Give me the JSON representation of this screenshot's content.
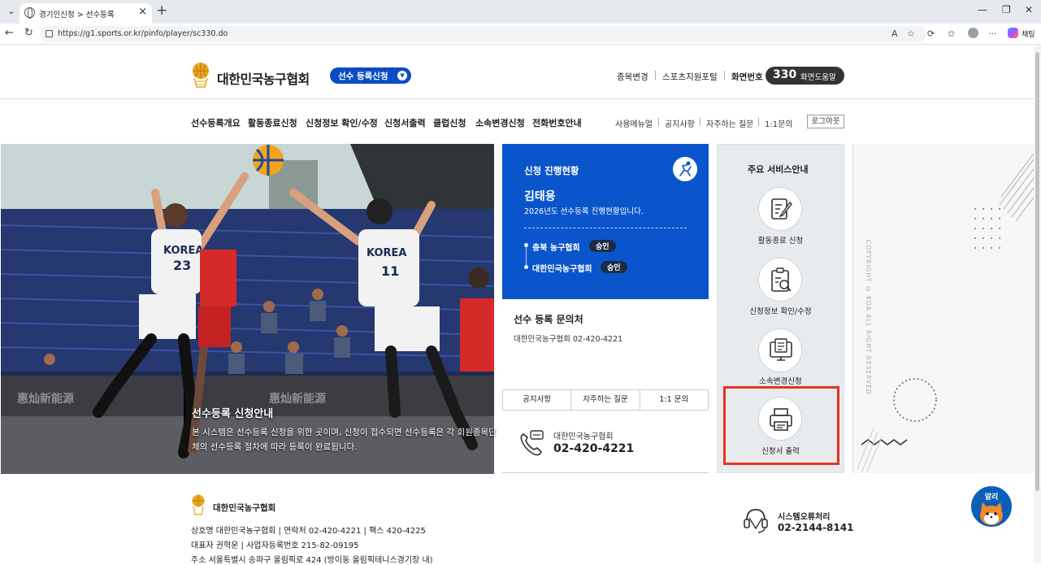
{
  "browser": {
    "tab_title": "경기인신청 > 선수등록",
    "url": "https://g1.sports.or.kr/pinfo/player/sc330.do",
    "chat_label": "채팅"
  },
  "header": {
    "org_name": "대한민국농구협회",
    "service_select": "선수 등록신청",
    "top_links": [
      "종목변경",
      "스포츠지원포털"
    ],
    "phone_label": "화면번호",
    "screen_number": "330",
    "help_label": "화면도움말"
  },
  "gnb": {
    "items": [
      "선수등록개요",
      "활동종료신청",
      "신청정보 확인/수정",
      "신청서출력",
      "클럽신청",
      "소속변경신청",
      "전화번호안내"
    ],
    "sub_links": [
      "사용메뉴얼",
      "공지사항",
      "자주하는 질문",
      "1:1문의"
    ],
    "logout": "로그아웃"
  },
  "hero": {
    "title": "선수등록 신청안내",
    "text": "본 시스템은 선수등록 신청을 위한 곳이며, 신청이 접수되면 선수등록은 각 회원종목단체의 선수등록 절차에 따라 등록이 완료됩니다."
  },
  "progress": {
    "title": "신청 진행현황",
    "name": "김태용",
    "desc": "2026년도 선수등록 진행현황입니다.",
    "steps": [
      {
        "org": "충북 농구협회",
        "status": "승인"
      },
      {
        "org": "대한민국농구협회",
        "status": "승인"
      }
    ]
  },
  "inquiry": {
    "title": "선수 등록 문의처",
    "text": "대한민국농구협회   02-420-4221",
    "tabs": [
      "공지사항",
      "자주하는 질문",
      "1:1 문의"
    ],
    "phone_org": "대한민국농구협회",
    "phone_number": "02-420-4221"
  },
  "services": {
    "title": "주요 서비스안내",
    "items": [
      {
        "label": "활동종료 신청",
        "icon": "document-pen-icon"
      },
      {
        "label": "신청정보 확인/수정",
        "icon": "clipboard-search-icon"
      },
      {
        "label": "소속변경신청",
        "icon": "monitor-document-icon"
      },
      {
        "label": "신청서 출력",
        "icon": "printer-icon"
      }
    ]
  },
  "deco": {
    "copyright": "COPYRIGHT © KOA ALL RIGHT RESERVED."
  },
  "footer": {
    "org": "대한민국농구협회",
    "line1": "상호명  대한민국농구협회   |   연락처  02-420-4221   |   팩스  420-4225",
    "line2": "대표자  권혁운   |   사업자등록번호  215-82-09195",
    "line3": "주소  서울특별시 송파구 올림픽로 424 (방이동 올림픽테니스경기장 내)",
    "err_title": "시스템오류처리",
    "err_number": "02-2144-8141",
    "alert_label": "알리"
  },
  "colors": {
    "brand_blue": "#0a55cc",
    "highlight_red": "#e8321e",
    "badge_dark": "#1d2b44"
  }
}
